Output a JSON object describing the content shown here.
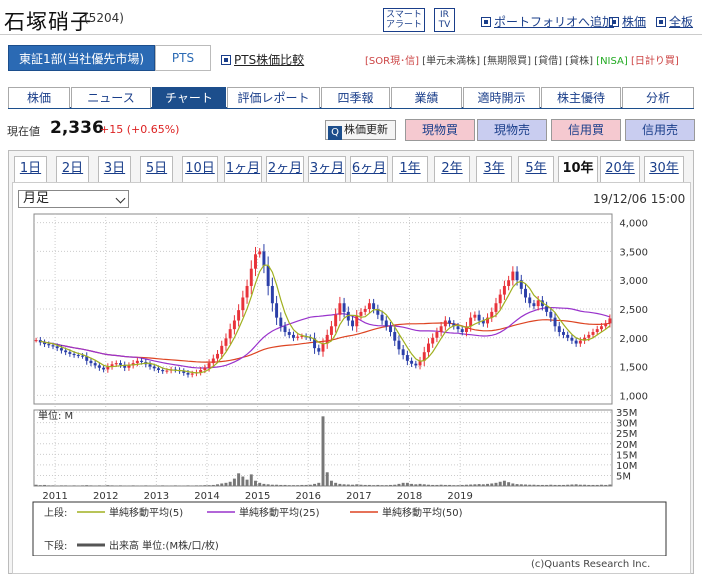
{
  "header": {
    "title": "石塚硝子",
    "code": "(5204)",
    "alert_line1": "スマート",
    "alert_line2": "アラート",
    "ir_line1": "IR",
    "ir_line2": "TV",
    "link_portfolio": "ポートフォリオへ追加",
    "link_kabuka": "株価",
    "link_zenban": "全板"
  },
  "market": {
    "primary": "東証1部(当社優先市場)",
    "pts": "PTS",
    "pts_compare": "PTS株価比較",
    "badges": [
      "[SOR現･信]",
      "[単元未満株]",
      "[無期限買]",
      "[貸借]",
      "[貸株]",
      "[NISA]",
      "[日計り買]"
    ]
  },
  "tabs": [
    "株価",
    "ニュース",
    "チャート",
    "評価レポート",
    "四季報",
    "業績",
    "適時開示",
    "株主優待",
    "分析"
  ],
  "active_tab": 2,
  "price": {
    "label": "現在値",
    "value": "2,336",
    "change": "+15 (+0.65%)",
    "refresh": "株価更新",
    "refresh_icon": "Q",
    "buttons": [
      "現物買",
      "現物売",
      "信用買",
      "信用売"
    ]
  },
  "periods": [
    "1日",
    "2日",
    "3日",
    "5日",
    "10日",
    "1ヶ月",
    "2ヶ月",
    "3ヶ月",
    "6ヶ月",
    "1年",
    "2年",
    "3年",
    "5年",
    "10年",
    "20年",
    "30年"
  ],
  "active_period": 13,
  "chart_controls": {
    "interval": "月足",
    "timestamp": "19/12/06 15:00",
    "volume_unit": "単位: M"
  },
  "legend": {
    "upper_label": "上段:",
    "ma5": "単純移動平均(5)",
    "ma25": "単純移動平均(25)",
    "ma50": "単純移動平均(50)",
    "lower_label": "下段:",
    "volume": "出来高 単位:(M株/口/枚)"
  },
  "copyright": "(c)Quants Research Inc.",
  "colors": {
    "up": "#e8333a",
    "down": "#2b3fa8",
    "ma5": "#a0b020",
    "ma25": "#9933cc",
    "ma50": "#dd4422",
    "volume": "#777777"
  },
  "chart_data": {
    "type": "candlestick",
    "x_tick_labels": [
      "2011",
      "2012",
      "2013",
      "2014",
      "2015",
      "2016",
      "2017",
      "2018",
      "2019"
    ],
    "price_ticks": [
      1000,
      1500,
      2000,
      2500,
      3000,
      3500,
      4000
    ],
    "price_tick_labels": [
      "1,000",
      "1,500",
      "2,000",
      "2,500",
      "3,000",
      "3,500",
      "4,000"
    ],
    "ylim": [
      850,
      4150
    ],
    "volume_ticks": [
      5,
      10,
      15,
      20,
      25,
      30,
      35
    ],
    "volume_tick_labels": [
      "5M",
      "10M",
      "15M",
      "20M",
      "25M",
      "30M",
      "35M"
    ],
    "volume_ylim": [
      0,
      36
    ],
    "close": [
      1960,
      1920,
      1890,
      1870,
      1850,
      1820,
      1780,
      1750,
      1720,
      1700,
      1690,
      1680,
      1600,
      1560,
      1520,
      1480,
      1450,
      1500,
      1540,
      1560,
      1530,
      1480,
      1520,
      1560,
      1600,
      1580,
      1540,
      1500,
      1470,
      1440,
      1420,
      1430,
      1450,
      1440,
      1420,
      1390,
      1360,
      1380,
      1400,
      1440,
      1480,
      1560,
      1640,
      1720,
      1860,
      1990,
      2150,
      2300,
      2480,
      2700,
      2900,
      3200,
      3450,
      3500,
      3250,
      2900,
      2600,
      2350,
      2200,
      2100,
      2050,
      2000,
      2020,
      2030,
      2010,
      1990,
      1820,
      1760,
      1900,
      2050,
      2200,
      2400,
      2600,
      2450,
      2300,
      2200,
      2380,
      2450,
      2500,
      2600,
      2500,
      2400,
      2300,
      2200,
      2100,
      1950,
      1800,
      1700,
      1600,
      1550,
      1520,
      1600,
      1750,
      1900,
      2000,
      2100,
      2200,
      2300,
      2250,
      2200,
      2150,
      2100,
      2200,
      2350,
      2400,
      2300,
      2250,
      2350,
      2450,
      2600,
      2750,
      2900,
      3000,
      3150,
      3000,
      2850,
      2700,
      2600,
      2550,
      2650,
      2550,
      2450,
      2350,
      2200,
      2100,
      2050,
      2000,
      1950,
      1900,
      1950,
      2000,
      2050,
      2100,
      2150,
      2200,
      2250,
      2336
    ],
    "volume": [
      0.6,
      0.4,
      0.5,
      0.3,
      0.3,
      0.2,
      0.3,
      0.3,
      0.2,
      0.3,
      0.2,
      0.3,
      0.4,
      0.3,
      0.2,
      0.3,
      0.2,
      0.4,
      0.3,
      0.2,
      0.3,
      0.2,
      0.2,
      0.3,
      0.2,
      0.2,
      0.3,
      0.2,
      0.2,
      0.2,
      0.3,
      0.2,
      0.2,
      0.3,
      0.2,
      0.2,
      0.3,
      0.2,
      0.3,
      0.3,
      0.4,
      0.4,
      0.5,
      0.8,
      1.2,
      1.5,
      2.0,
      3.5,
      6.0,
      4.5,
      3.0,
      5.5,
      2.5,
      1.5,
      1.0,
      0.8,
      0.6,
      0.6,
      0.5,
      0.5,
      0.4,
      0.4,
      0.4,
      0.5,
      0.5,
      0.6,
      1.0,
      1.5,
      33.0,
      6.5,
      2.5,
      1.5,
      1.0,
      0.8,
      0.7,
      0.6,
      0.8,
      0.6,
      0.5,
      0.5,
      0.4,
      0.5,
      0.4,
      0.4,
      0.5,
      0.6,
      1.0,
      1.5,
      1.5,
      1.0,
      0.8,
      1.0,
      0.8,
      0.6,
      0.5,
      0.5,
      0.6,
      0.5,
      0.5,
      0.4,
      0.4,
      0.5,
      0.6,
      0.7,
      0.8,
      0.9,
      0.8,
      1.0,
      1.2,
      1.5,
      2.0,
      2.5,
      1.8,
      1.2,
      0.9,
      0.8,
      0.7,
      0.6,
      0.6,
      0.5,
      0.5,
      0.5,
      0.6,
      0.5,
      0.5,
      0.5,
      0.6,
      0.7,
      0.8,
      0.6,
      0.6,
      0.5,
      0.5,
      0.5,
      0.6,
      0.5,
      0.7
    ]
  }
}
